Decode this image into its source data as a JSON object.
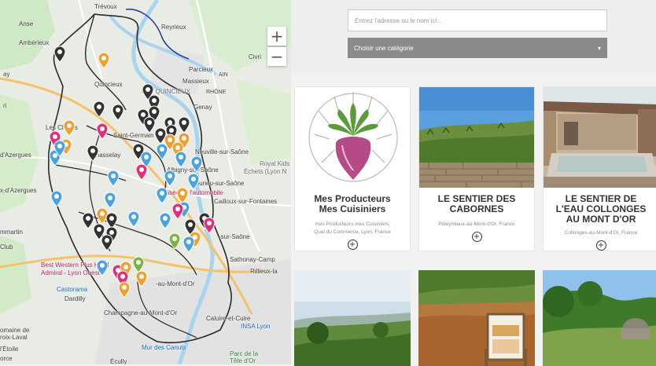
{
  "map": {
    "zoom_in": "+",
    "zoom_out": "−",
    "labels": {
      "trevoux": "Trévoux",
      "reyrieux": "Reyrieux",
      "anse": "Anse",
      "amberieux": "Ambérieux",
      "civri": "Civri",
      "parcieux": "Parcieux",
      "massieux": "Massieux",
      "quincieux": "Quincieux",
      "ain": "AIN",
      "rhone": "RHÔNE",
      "cat_quincieux": "CAT QUINCIEUX",
      "genay": "Genay",
      "les_cheres": "Les Chères",
      "d_azergues": "d'Azergues",
      "saint_germain": "Saint-Germain",
      "chasselay": "Chasselay",
      "neuville": "Neuville-sur-Saône",
      "albigny": "Albigny-sur-Saône",
      "royal_kids": "Royal Kids",
      "echets": "Échets (Lyon N",
      "fleurieu": "Fleurieu-sur-Saône",
      "musee": "Musée de l'automobile",
      "cailloux": "Cailloux-sur-Fontaines",
      "x_dazergues": "x-d'Azergues",
      "mmartin": "mmartin",
      "club": "Club",
      "sur_saone": "-sur-Saône",
      "sathonay": "Sathonay-Camp",
      "rillieux": "Rillieux-la",
      "best_western": "Best Western Plus Hôtel",
      "admiral": "Admiral - Lyon Ouest",
      "castorama": "Castorama",
      "dardilly": "Dardilly",
      "mont_dor": "-au-Mont-d'Or",
      "champagne": "Champagne-au-Mont-d'Or",
      "caluire": "Caluire-et-Cuire",
      "insa": "INSA Lyon",
      "domaine": "omaine de",
      "croix_laval": "roix-Laval",
      "etoile": "l'Étoile",
      "orce": "orce",
      "canuts": "Mur des Canuts",
      "parc": "Parc de la",
      "tete": "Tête d'Or",
      "ecully": "Écully",
      "ay": "ay",
      "ri": "ri"
    }
  },
  "search": {
    "placeholder": "Entrez l'adresse ou le nom ici..."
  },
  "category": {
    "label": "Choisir une catégorie",
    "arrow": "▾"
  },
  "cards": [
    {
      "title_line1": "Mes Producteurs",
      "title_line2": "Mes Cuisiniers",
      "addr_line1": "mes Producteurs mes Cuisiniers,",
      "addr_line2": "Quai du Commerce, Lyon, France",
      "plus": "+"
    },
    {
      "title_line1": "LE SENTIER DES",
      "title_line2": "CABORNES",
      "addr_line1": "Poleymieux-au-Mont-d'Or, France",
      "plus": "+"
    },
    {
      "title_line1": "LE SENTIER DE",
      "title_line2": "L'EAU COLLONGES",
      "title_line3": "AU MONT D'OR",
      "addr_line1": "Collonges-au-Mont-d'Or, France",
      "plus": "+"
    }
  ],
  "colors": {
    "pin_dark": "#333333",
    "pin_orange": "#f0a030",
    "pin_blue": "#4aa3df",
    "pin_pink": "#e0307a",
    "pin_green": "#7cb342",
    "route": "#2a2a2a",
    "saone": "#a8d4f0",
    "category_bg": "#8a8a8a"
  }
}
